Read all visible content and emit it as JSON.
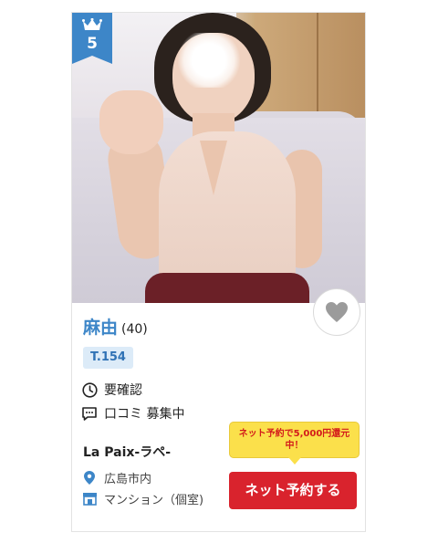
{
  "card": {
    "rank": "5",
    "name": "麻由",
    "age": "(40)",
    "tag": "T.154",
    "time_label": "要確認",
    "review_label": "口コミ 募集中",
    "shop_name": "La Paix-ラペ-",
    "area": "広島市内",
    "place": "マンション（個室)",
    "promo_text": "ネット予約で5,000円還元中！",
    "reserve_label": "ネット予約する"
  },
  "colors": {
    "accent_blue": "#3d86c8",
    "reserve_red": "#d9232d",
    "promo_yellow": "#fbe04b"
  },
  "icons": {
    "rank": "crown-icon",
    "favorite": "heart-icon",
    "time": "clock-icon",
    "review": "chat-icon",
    "area": "location-pin-icon",
    "place": "building-icon"
  }
}
